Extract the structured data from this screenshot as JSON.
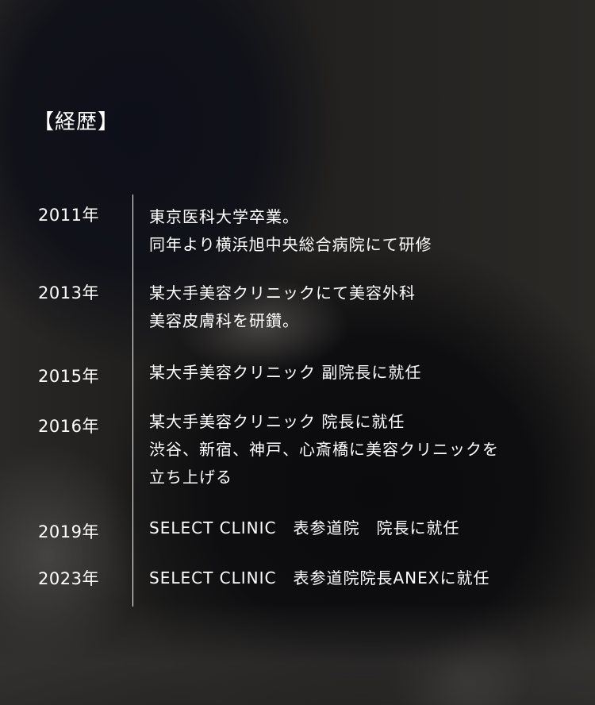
{
  "heading": "【経歴】",
  "career": [
    {
      "year": "2011年",
      "lines": [
        "東京医科大学卒業。",
        "同年より横浜旭中央総合病院にて研修"
      ]
    },
    {
      "year": "2013年",
      "lines": [
        "某大手美容クリニックにて美容外科",
        "美容皮膚科を研鑽。"
      ]
    },
    {
      "year": "2015年",
      "lines": [
        "某大手美容クリニック 副院長に就任"
      ]
    },
    {
      "year": "2016年",
      "lines": [
        "某大手美容クリニック 院長に就任",
        "渋谷、新宿、神戸、心斎橋に美容クリニックを",
        "立ち上げる"
      ]
    },
    {
      "year": "2019年",
      "lines": [
        "SELECT CLINIC　表参道院　院長に就任"
      ]
    },
    {
      "year": "2023年",
      "lines": [
        "SELECT CLINIC　表参道院院長ANEXに就任"
      ]
    }
  ]
}
